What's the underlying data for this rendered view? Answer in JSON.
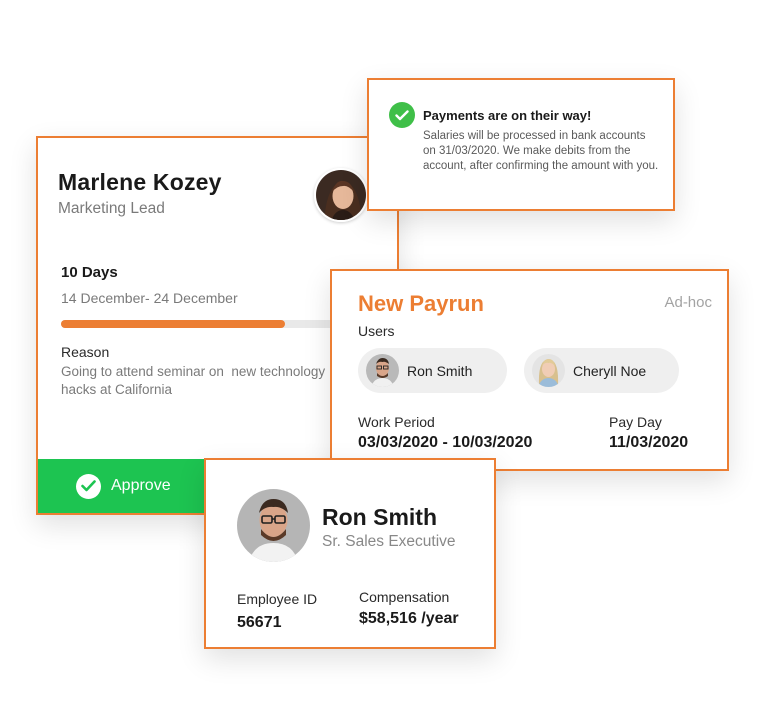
{
  "leave_request": {
    "name": "Marlene Kozey",
    "role": "Marketing Lead",
    "days": "10 Days",
    "date_range": "14 December- 24 December",
    "progress": 0.8,
    "reason_label": "Reason",
    "reason_text": "Going to attend seminar on  new technology\nhacks at California",
    "approve_label": "Approve"
  },
  "notification": {
    "title": "Payments are on their way!",
    "body": "Salaries will be processed in bank accounts on 31/03/2020. We make debits from the account, after confirming the amount with you."
  },
  "payrun": {
    "title": "New Payrun",
    "tag": "Ad-hoc",
    "users_label": "Users",
    "users": [
      {
        "name": "Ron Smith"
      },
      {
        "name": "Cheryll Noe"
      }
    ],
    "work_period_label": "Work Period",
    "work_period_value": "03/03/2020 - 10/03/2020",
    "pay_day_label": "Pay Day",
    "pay_day_value": "11/03/2020"
  },
  "employee": {
    "name": "Ron Smith",
    "role": "Sr. Sales Executive",
    "id_label": "Employee ID",
    "id_value": "56671",
    "compensation_label": "Compensation",
    "compensation_value": "$58,516 /year"
  },
  "colors": {
    "accent": "#ec7e33",
    "approve": "#1dc451",
    "success": "#3fbf48"
  }
}
